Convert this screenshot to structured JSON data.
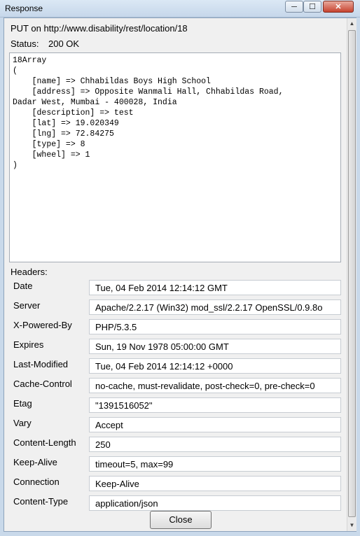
{
  "window": {
    "title": "Response",
    "minimize_icon": "minimize-icon",
    "maximize_icon": "maximize-icon",
    "close_icon": "close-icon"
  },
  "request": {
    "line": "PUT on http://www.disability/rest/location/18",
    "status_label": "Status:",
    "status_value": "200 OK"
  },
  "response_body": "18Array\n(\n    [name] => Chhabildas Boys High School\n    [address] => Opposite Wanmali Hall, Chhabildas Road,\nDadar West, Mumbai - 400028, India\n    [description] => test\n    [lat] => 19.020349\n    [lng] => 72.84275\n    [type] => 8\n    [wheel] => 1\n)",
  "headers_label": "Headers:",
  "headers": [
    {
      "name": "Date",
      "value": "Tue, 04 Feb 2014 12:14:12 GMT"
    },
    {
      "name": "Server",
      "value": "Apache/2.2.17 (Win32) mod_ssl/2.2.17 OpenSSL/0.9.8o"
    },
    {
      "name": "X-Powered-By",
      "value": "PHP/5.3.5"
    },
    {
      "name": "Expires",
      "value": "Sun, 19 Nov 1978 05:00:00 GMT"
    },
    {
      "name": "Last-Modified",
      "value": "Tue, 04 Feb 2014 12:14:12 +0000"
    },
    {
      "name": "Cache-Control",
      "value": "no-cache, must-revalidate, post-check=0, pre-check=0"
    },
    {
      "name": "Etag",
      "value": "\"1391516052\""
    },
    {
      "name": "Vary",
      "value": "Accept"
    },
    {
      "name": "Content-Length",
      "value": "250"
    },
    {
      "name": "Keep-Alive",
      "value": "timeout=5, max=99"
    },
    {
      "name": "Connection",
      "value": "Keep-Alive"
    },
    {
      "name": "Content-Type",
      "value": "application/json"
    }
  ],
  "close_button": "Close"
}
